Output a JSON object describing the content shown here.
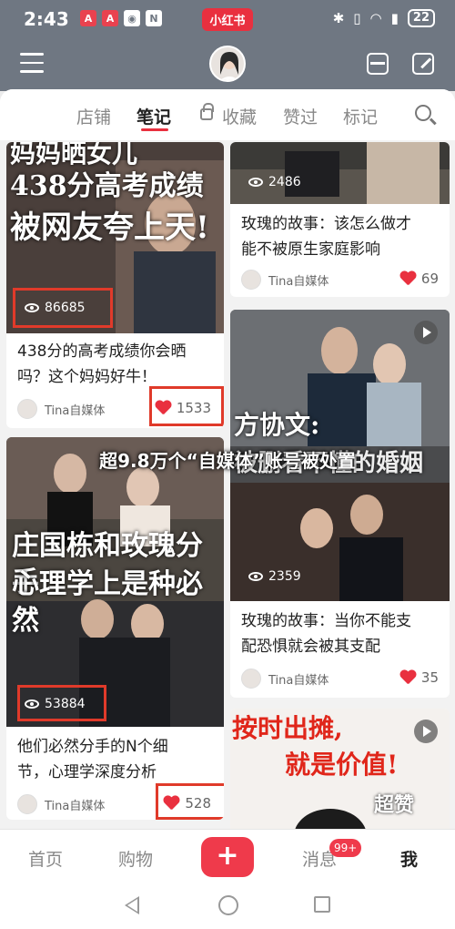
{
  "status": {
    "time": "2:43",
    "left_icons": [
      "A",
      "A",
      "◉",
      "N"
    ],
    "app_logo": "小红书",
    "battery": "22"
  },
  "tabs": [
    {
      "label": "店铺"
    },
    {
      "label": "笔记"
    },
    {
      "label": "收藏"
    },
    {
      "label": "赞过"
    },
    {
      "label": "标记"
    }
  ],
  "cards": [
    {
      "cover_text_lines": [
        "妈妈晒女儿",
        "438分高考成绩",
        "被网友夸上天!"
      ],
      "views": "86685",
      "title_lines": [
        "438分的高考成绩你会晒",
        "吗？这个妈妈好牛！"
      ],
      "author": "Tina自媒体",
      "likes": "1533"
    },
    {
      "views": "2486",
      "title_lines": [
        "玫瑰的故事：该怎么做才",
        "能不被原生家庭影响"
      ],
      "author": "Tina自媒体",
      "likes": "69"
    },
    {
      "cover_text_lines": [
        "庄国栋和玫瑰分手",
        "心理学上是种必然"
      ],
      "views": "53884",
      "title_lines": [
        "他们必然分手的N个细",
        "节，心理学深度分析"
      ],
      "author": "Tina自媒体",
      "likes": "528"
    },
    {
      "cover_text_lines": [
        "方协文:",
        "被删看不懂的婚姻"
      ],
      "views": "2359",
      "title_lines": [
        "玫瑰的故事：当你不能支",
        "配恐惧就会被其支配"
      ],
      "author": "Tina自媒体",
      "likes": "35"
    },
    {
      "cover_text_lines": [
        "按时出摊,",
        "就是价值!"
      ],
      "sticker": "超赞"
    }
  ],
  "caption": "超9.8万个“自媒体”账号被处置",
  "bottom_nav": {
    "home": "首页",
    "shop": "购物",
    "plus": "+",
    "messages": "消息",
    "messages_badge": "99+",
    "me": "我"
  },
  "colors": {
    "accent": "#e9303f",
    "highlight_box": "#e03a2a"
  }
}
